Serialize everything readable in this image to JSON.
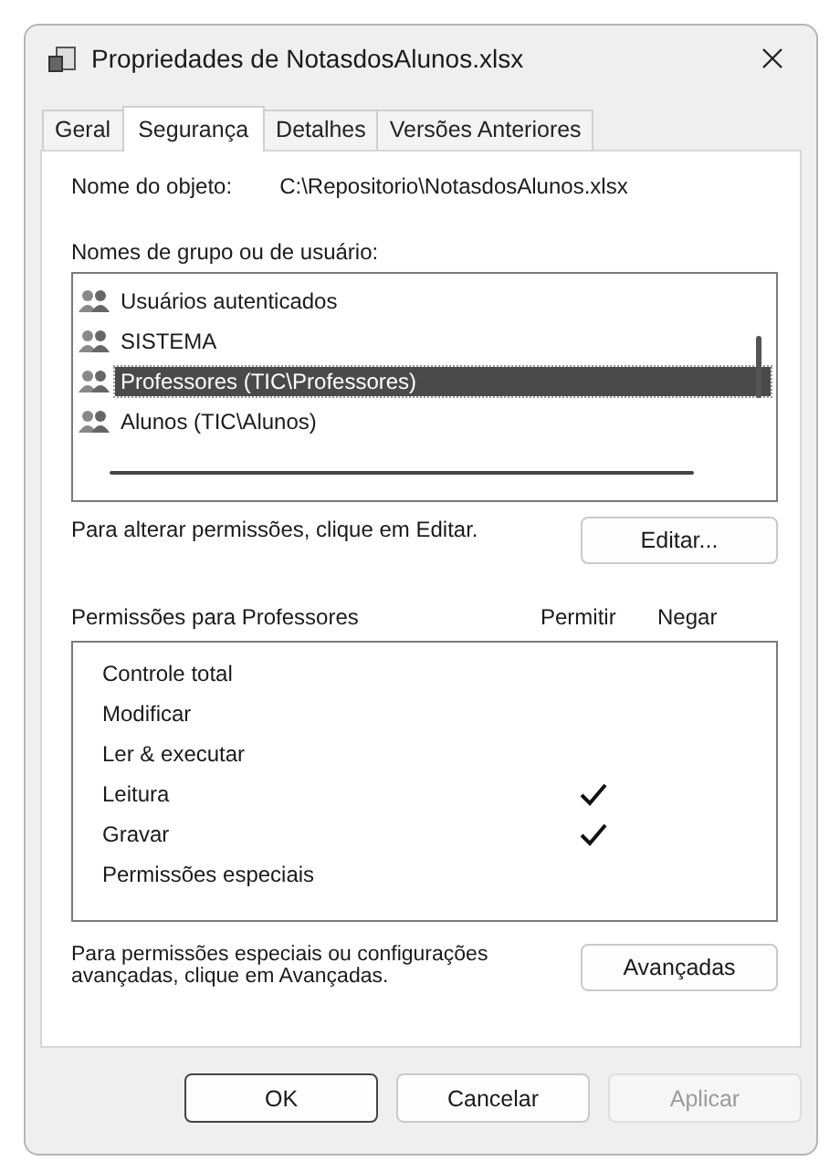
{
  "window": {
    "title": "Propriedades de NotasdosAlunos.xlsx"
  },
  "tabs": [
    {
      "label": "Geral",
      "selected": false
    },
    {
      "label": "Segurança",
      "selected": true
    },
    {
      "label": "Detalhes",
      "selected": false
    },
    {
      "label": "Versões Anteriores",
      "selected": false
    }
  ],
  "object_name": {
    "label": "Nome do objeto:",
    "value": "C:\\Repositorio\\NotasdosAlunos.xlsx"
  },
  "groups": {
    "label": "Nomes de grupo ou de usuário:",
    "items": [
      {
        "name": "Usuários autenticados",
        "selected": false
      },
      {
        "name": "SISTEMA",
        "selected": false
      },
      {
        "name": "Professores (TIC\\Professores)",
        "selected": true
      },
      {
        "name": "Alunos (TIC\\Alunos)",
        "selected": false
      }
    ]
  },
  "edit_hint": "Para alterar permissões, clique em Editar.",
  "edit_button": "Editar...",
  "permissions": {
    "label": "Permissões para Professores",
    "allow_header": "Permitir",
    "deny_header": "Negar",
    "rows": [
      {
        "name": "Controle total",
        "allow": false,
        "deny": false
      },
      {
        "name": "Modificar",
        "allow": false,
        "deny": false
      },
      {
        "name": "Ler & executar",
        "allow": false,
        "deny": false
      },
      {
        "name": "Leitura",
        "allow": true,
        "deny": false
      },
      {
        "name": "Gravar",
        "allow": true,
        "deny": false
      },
      {
        "name": "Permissões especiais",
        "allow": false,
        "deny": false
      }
    ]
  },
  "advanced_hint": "Para permissões especiais ou configurações avançadas, clique em Avançadas.",
  "advanced_button": "Avançadas",
  "buttons": [
    {
      "label": "OK",
      "disabled": false,
      "default": true
    },
    {
      "label": "Cancelar",
      "disabled": false,
      "default": false
    },
    {
      "label": "Aplicar",
      "disabled": true,
      "default": false
    }
  ]
}
